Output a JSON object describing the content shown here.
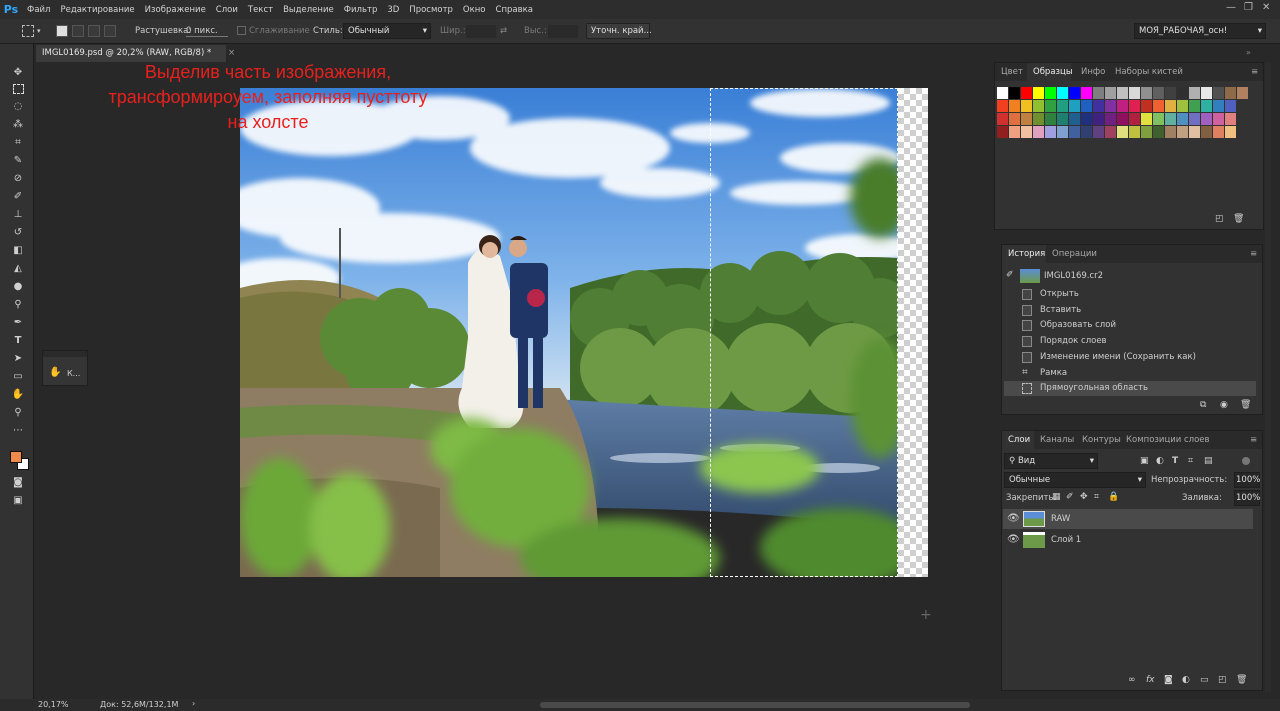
{
  "menubar": {
    "logo": "Ps",
    "items": [
      "Файл",
      "Редактирование",
      "Изображение",
      "Слои",
      "Текст",
      "Выделение",
      "Фильтр",
      "3D",
      "Просмотр",
      "Окно",
      "Справка"
    ],
    "window_controls": [
      "—",
      "❐",
      "✕"
    ]
  },
  "options": {
    "feather_label": "Растушевка:",
    "feather_value": "0 пикс.",
    "antialias_label": "Сглаживание",
    "style_label": "Стиль:",
    "style_value": "Обычный",
    "width_label": "Шир.:",
    "height_label": "Выс.:",
    "refine_button": "Уточн. край...",
    "workspace": "МОЯ_РАБОЧАЯ_осн!"
  },
  "document": {
    "tab_title": "IMGL0169.psd @ 20,2% (RAW, RGB/8) *",
    "close": "×"
  },
  "annotation": {
    "line1": "Выделив часть изображения,",
    "line2": "трансформироуем, заполняя пусттоту",
    "line3": "на холсте"
  },
  "minipanel": {
    "label": "К..."
  },
  "swatches_panel": {
    "tabs": [
      "Цвет",
      "Образцы",
      "Инфо",
      "Наборы кистей"
    ],
    "active_tab": "Образцы",
    "row1": [
      "#ffffff",
      "#000000",
      "#ff0000",
      "#ffff00",
      "#00ff00",
      "#00ffff",
      "#0000ff",
      "#ff00ff",
      "#7f7f7f",
      "#a0a0a0",
      "#c0c0c0",
      "#d8d8d8",
      "#909090",
      "#606060",
      "#404040",
      "#303030",
      "#b0b0b0",
      "#e8e8e8",
      "#505050",
      "#8c6a4a",
      "#b08060"
    ],
    "row2": [
      "#f04020",
      "#f08020",
      "#f0c020",
      "#90c030",
      "#30a040",
      "#20a080",
      "#20a0c0",
      "#2060c0",
      "#4030a0",
      "#8030a0",
      "#c02080",
      "#e02050",
      "#c03020",
      "#f06030",
      "#e0b040",
      "#a0c040",
      "#40a050",
      "#30b0a0",
      "#3080c0",
      "#5060c0"
    ],
    "row3": [
      "#d03030",
      "#e07040",
      "#c08040",
      "#709030",
      "#308040",
      "#208070",
      "#206090",
      "#203080",
      "#402080",
      "#702080",
      "#901060",
      "#b02040",
      "#e0e040",
      "#80c060",
      "#60b0a0",
      "#5090c0",
      "#7070c0",
      "#a060c0",
      "#d060a0",
      "#e08080"
    ],
    "row4": [
      "#902020",
      "#f0a080",
      "#f0c0a0",
      "#e0a0c0",
      "#a0a0e0",
      "#80a0d0",
      "#4060a0",
      "#304070",
      "#604080",
      "#a04060",
      "#e0e080",
      "#c0c040",
      "#80a040",
      "#406030",
      "#a08060",
      "#c0a080",
      "#e0c0a0",
      "#806040",
      "#e08060",
      "#f0c080"
    ]
  },
  "history_panel": {
    "tabs": [
      "История",
      "Операции"
    ],
    "active_tab": "История",
    "snapshot": "IMGL0169.cr2",
    "items": [
      "Открыть",
      "Вставить",
      "Образовать слой",
      "Порядок слоев",
      "Изменение имени (Сохранить как)",
      "Рамка",
      "Прямоугольная область"
    ],
    "selected_item": "Прямоугольная область"
  },
  "layers_panel": {
    "tabs": [
      "Слои",
      "Каналы",
      "Контуры",
      "Композиции слоев"
    ],
    "active_tab": "Слои",
    "filter": "Вид",
    "blend_mode": "Обычные",
    "opacity_label": "Непрозрачность:",
    "opacity_value": "100%",
    "lock_label": "Закрепить:",
    "fill_label": "Заливка:",
    "fill_value": "100%",
    "layers": [
      {
        "name": "RAW",
        "selected": true
      },
      {
        "name": "Слой 1",
        "selected": false
      }
    ]
  },
  "status": {
    "zoom": "20,17%",
    "doc": "Док: 52,6M/132,1M",
    "arrow": "›"
  },
  "colors": {
    "annotation": "#e8201c",
    "foreground": "#f08a4b",
    "background": "#ffffff",
    "ps_blue": "#31a8ff"
  }
}
